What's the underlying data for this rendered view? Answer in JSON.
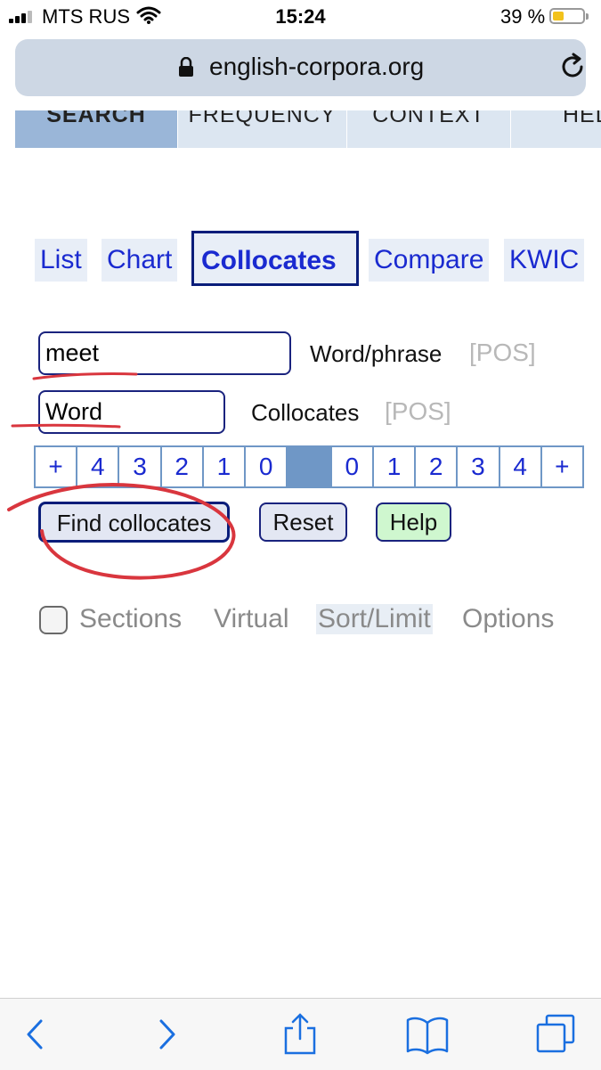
{
  "status_bar": {
    "carrier": "MTS RUS",
    "time": "15:24",
    "battery_percent": "39 %",
    "battery_level": 0.39
  },
  "browser": {
    "url": "english-corpora.org"
  },
  "nav": {
    "tabs": [
      {
        "label": "SEARCH",
        "active": true
      },
      {
        "label": "FREQUENCY",
        "active": false
      },
      {
        "label": "CONTEXT",
        "active": false
      },
      {
        "label": "HEL",
        "active": false
      }
    ]
  },
  "modes": [
    {
      "label": "List",
      "active": false
    },
    {
      "label": "Chart",
      "active": false
    },
    {
      "label": "Collocates",
      "active": true
    },
    {
      "label": "Compare",
      "active": false
    },
    {
      "label": "KWIC",
      "active": false
    }
  ],
  "form": {
    "word_value": "meet",
    "word_label": "Word/phrase",
    "word_pos": "[POS]",
    "collocate_value": "Word",
    "collocate_label": "Collocates",
    "collocate_pos": "[POS]",
    "span_cells": [
      "+",
      "4",
      "3",
      "2",
      "1",
      "0",
      "",
      "0",
      "1",
      "2",
      "3",
      "4",
      "+"
    ],
    "find_label": "Find collocates",
    "reset_label": "Reset",
    "help_label": "Help"
  },
  "options": {
    "sections_checked": false,
    "sections_label": "Sections",
    "virtual_label": "Virtual",
    "sort_label": "Sort/Limit",
    "options_label": "Options"
  },
  "colors": {
    "link_blue": "#1a2ad0",
    "active_tab": "#9ab6d8",
    "span_highlight": "#6f97c6",
    "annotation_red": "#d9363e",
    "help_green": "#cff7cf"
  },
  "icons": {
    "back": "chevron-left-icon",
    "forward": "chevron-right-icon",
    "share": "share-icon",
    "bookmarks": "book-icon",
    "tabs": "tabs-icon"
  }
}
